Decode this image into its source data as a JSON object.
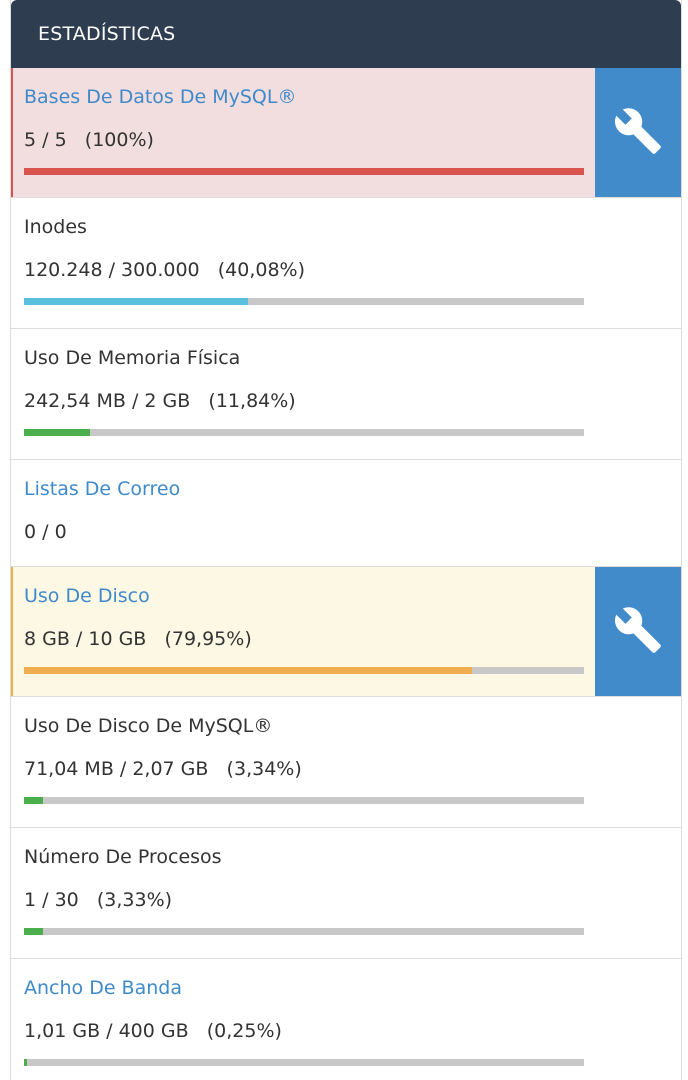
{
  "header": {
    "title": "ESTADÍSTICAS"
  },
  "stats": [
    {
      "label": "Bases De Datos De MySQL®",
      "value": "5 / 5   (100%)",
      "percent": 100,
      "bar_color": "#d9534f",
      "state": "danger",
      "is_link": true,
      "has_action": true,
      "action_icon": "wrench-icon"
    },
    {
      "label": "Inodes",
      "value": "120.248 / 300.000   (40,08%)",
      "percent": 40.08,
      "bar_color": "#5bc0de",
      "state": "normal",
      "is_link": false,
      "has_action": false
    },
    {
      "label": "Uso De Memoria Física",
      "value": "242,54 MB / 2 GB   (11,84%)",
      "percent": 11.84,
      "bar_color": "#4cae4c",
      "state": "normal",
      "is_link": false,
      "has_action": false
    },
    {
      "label": "Listas De Correo",
      "value": "0 / 0",
      "percent": null,
      "state": "normal",
      "is_link": true,
      "has_action": false
    },
    {
      "label": "Uso De Disco",
      "value": "8 GB / 10 GB   (79,95%)",
      "percent": 79.95,
      "bar_color": "#f0ad4e",
      "state": "warning",
      "is_link": true,
      "has_action": true,
      "action_icon": "wrench-icon"
    },
    {
      "label": "Uso De Disco De MySQL®",
      "value": "71,04 MB / 2,07 GB   (3,34%)",
      "percent": 3.34,
      "bar_color": "#4cae4c",
      "state": "normal",
      "is_link": false,
      "has_action": false
    },
    {
      "label": "Número De Procesos",
      "value": "1 / 30   (3,33%)",
      "percent": 3.33,
      "bar_color": "#4cae4c",
      "state": "normal",
      "is_link": false,
      "has_action": false
    },
    {
      "label": "Ancho De Banda",
      "value": "1,01 GB / 400 GB   (0,25%)",
      "percent": 0.25,
      "bar_color": "#4cae4c",
      "state": "normal",
      "is_link": true,
      "has_action": false
    }
  ]
}
